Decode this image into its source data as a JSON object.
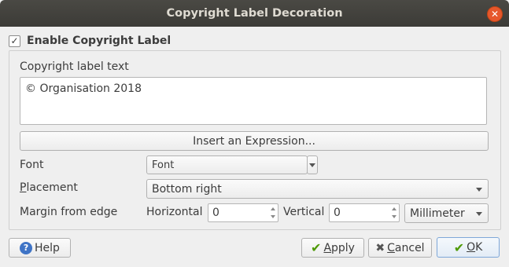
{
  "window": {
    "title": "Copyright Label Decoration"
  },
  "enable": {
    "label": "Enable Copyright Label",
    "checked_glyph": "✓"
  },
  "copyright": {
    "section_label": "Copyright label text",
    "text": "© Organisation 2018",
    "insert_expression_label": "Insert an Expression..."
  },
  "font": {
    "label": "Font",
    "button_label": "Font"
  },
  "placement": {
    "label_first": "P",
    "label_rest": "lacement",
    "value": "Bottom right"
  },
  "margin": {
    "label": "Margin from edge",
    "horizontal_label": "Horizontal",
    "horizontal_value": "0",
    "vertical_label": "Vertical",
    "vertical_value": "0",
    "unit": "Millimeter"
  },
  "footer": {
    "help_label": "Help",
    "apply_first": "A",
    "apply_rest": "pply",
    "cancel_first": "C",
    "cancel_rest": "ancel",
    "ok_first": "O",
    "ok_rest": "K"
  },
  "icons": {
    "close": "close-icon",
    "help": "help-icon",
    "apply": "checkmark-icon",
    "cancel": "cross-icon",
    "ok": "checkmark-icon"
  },
  "colors": {
    "titlebar": "#3c3b37",
    "close_button": "#e6572c",
    "help_icon": "#3f74c6",
    "check_green": "#4e9a06"
  }
}
